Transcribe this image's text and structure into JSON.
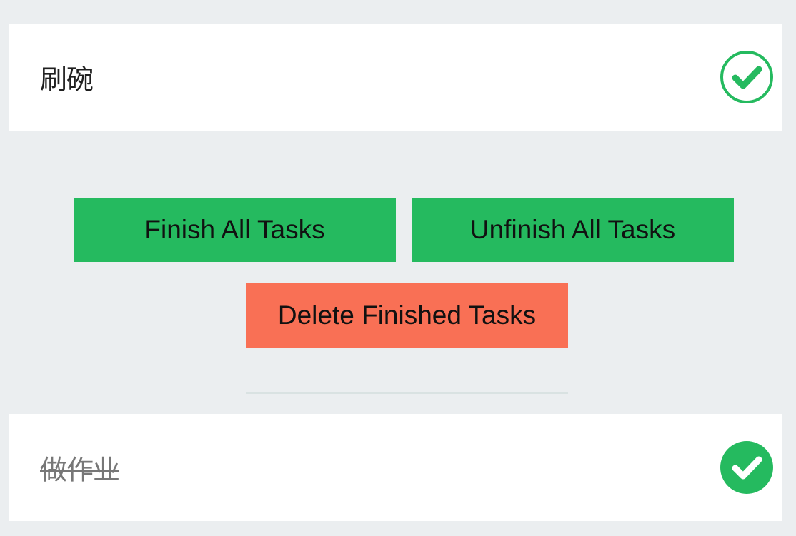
{
  "tasks": [
    {
      "label": "刷碗",
      "finished": false,
      "check_icon": "check-circle-outline-icon"
    },
    {
      "label": "做作业",
      "finished": true,
      "check_icon": "check-circle-filled-icon"
    }
  ],
  "actions": {
    "finish_all_label": "Finish All Tasks",
    "unfinish_all_label": "Unfinish All Tasks",
    "delete_finished_label": "Delete Finished Tasks"
  },
  "colors": {
    "background": "#ebeef0",
    "card": "#ffffff",
    "accent_green": "#25ba5f",
    "danger_red": "#f97055",
    "divider": "#d9e2e2",
    "finished_text": "#777777"
  }
}
